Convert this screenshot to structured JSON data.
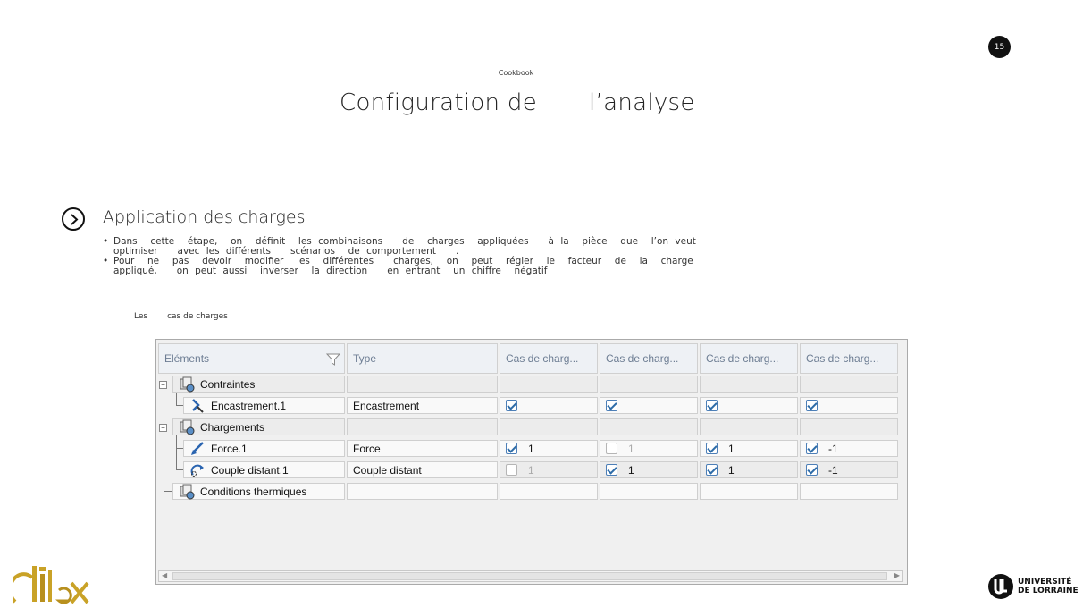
{
  "slide": {
    "page_number": "15",
    "kicker": "Cookbook",
    "title_part1": "Configuration de",
    "title_part2": "l’analyse",
    "section_title": "Application des charges",
    "bullets": [
      "Dans  cette  étape,  on  définit  les combinaisons   de  charges  appliquées   à la  pièce  que  l’on veut optimiser   avec les différents   scénarios  de comportement   .",
      "Pour  ne  pas  devoir  modifier  les  différentes   charges,  on  peut  régler  le  facteur  de  la  charge  appliqué,   on peut aussi  inverser  la direction   en entrant  un chiffre  négatif"
    ],
    "caption_part1": "Les",
    "caption_part2": "cas de charges"
  },
  "table": {
    "columns": [
      "Eléments",
      "Type",
      "Cas de charg...",
      "Cas de charg...",
      "Cas de charg...",
      "Cas de charg..."
    ],
    "rows": [
      {
        "name": "Contraintes",
        "type": "",
        "cases": [
          {
            "checked": null,
            "value": ""
          },
          {
            "checked": null,
            "value": ""
          },
          {
            "checked": null,
            "value": ""
          },
          {
            "checked": null,
            "value": ""
          }
        ]
      },
      {
        "name": "Encastrement.1",
        "type": "Encastrement",
        "cases": [
          {
            "checked": true,
            "value": ""
          },
          {
            "checked": true,
            "value": ""
          },
          {
            "checked": true,
            "value": ""
          },
          {
            "checked": true,
            "value": ""
          }
        ]
      },
      {
        "name": "Chargements",
        "type": "",
        "cases": [
          {
            "checked": null,
            "value": ""
          },
          {
            "checked": null,
            "value": ""
          },
          {
            "checked": null,
            "value": ""
          },
          {
            "checked": null,
            "value": ""
          }
        ]
      },
      {
        "name": "Force.1",
        "type": "Force",
        "cases": [
          {
            "checked": true,
            "value": "1"
          },
          {
            "checked": false,
            "value": "1"
          },
          {
            "checked": true,
            "value": "1"
          },
          {
            "checked": true,
            "value": "-1"
          }
        ]
      },
      {
        "name": "Couple distant.1",
        "type": "Couple distant",
        "cases": [
          {
            "checked": false,
            "value": "1"
          },
          {
            "checked": true,
            "value": "1"
          },
          {
            "checked": true,
            "value": "1"
          },
          {
            "checked": true,
            "value": "-1"
          }
        ]
      },
      {
        "name": "Conditions thermiques",
        "type": "",
        "cases": [
          {
            "checked": null,
            "value": ""
          },
          {
            "checked": null,
            "value": ""
          },
          {
            "checked": null,
            "value": ""
          },
          {
            "checked": null,
            "value": ""
          }
        ]
      }
    ]
  },
  "logos": {
    "right_line1": "UNIVERSITÉ",
    "right_line2": "DE LORRAINE"
  },
  "colors": {
    "header_text": "#6d7d93",
    "checkbox_blue": "#2e6ca8",
    "logo_gold": "#c9a227"
  }
}
